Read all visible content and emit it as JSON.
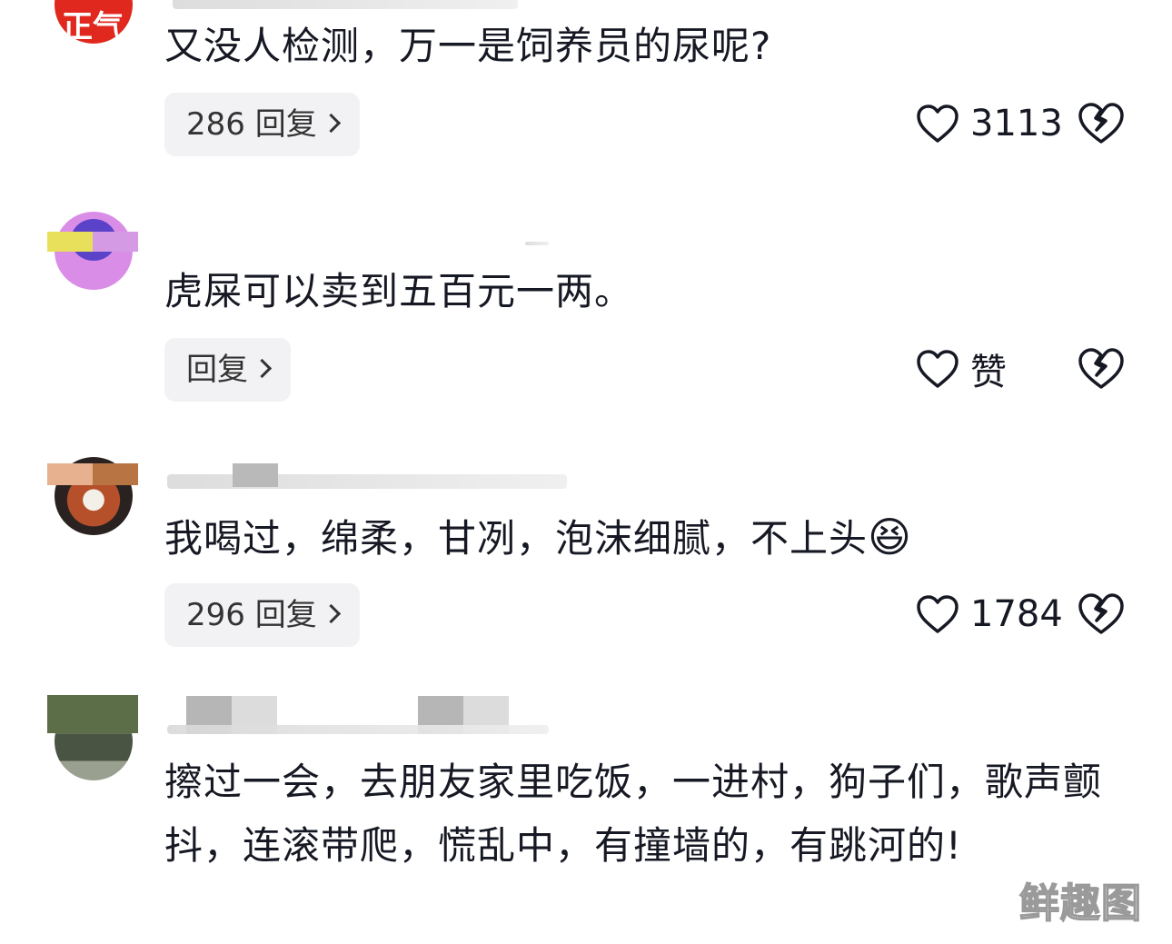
{
  "comments": [
    {
      "avatar_text": "正气",
      "text": "又没人检测，万一是饲养员的尿呢?",
      "reply_label": "286 回复",
      "likes": "3113"
    },
    {
      "text": "虎屎可以卖到五百元一两。",
      "reply_label": "回复",
      "likes": "赞"
    },
    {
      "text": "我喝过，绵柔，甘冽，泡沫细腻，不上头",
      "emoji": "😆",
      "reply_label": "296 回复",
      "likes": "1784"
    },
    {
      "text": "擦过一会，去朋友家里吃饭，一进村，狗子们，歌声颤抖，连滚带爬，慌乱中，有撞墙的，有跳河的!"
    }
  ],
  "watermark": "鲜趣图",
  "colors": {
    "text": "#161823",
    "reply_bg": "#f2f2f4",
    "avatar1": "#e0281e",
    "avatar2": "#c96ad6"
  },
  "icons": [
    "heart-outline-icon",
    "broken-heart-icon",
    "chevron-right-icon"
  ]
}
